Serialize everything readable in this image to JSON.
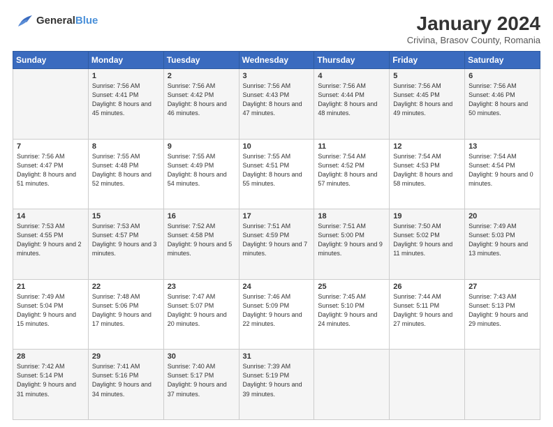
{
  "logo": {
    "general": "General",
    "blue": "Blue"
  },
  "title": "January 2024",
  "subtitle": "Crivina, Brasov County, Romania",
  "days_header": [
    "Sunday",
    "Monday",
    "Tuesday",
    "Wednesday",
    "Thursday",
    "Friday",
    "Saturday"
  ],
  "weeks": [
    [
      {
        "day": "",
        "sunrise": "",
        "sunset": "",
        "daylight": ""
      },
      {
        "day": "1",
        "sunrise": "Sunrise: 7:56 AM",
        "sunset": "Sunset: 4:41 PM",
        "daylight": "Daylight: 8 hours and 45 minutes."
      },
      {
        "day": "2",
        "sunrise": "Sunrise: 7:56 AM",
        "sunset": "Sunset: 4:42 PM",
        "daylight": "Daylight: 8 hours and 46 minutes."
      },
      {
        "day": "3",
        "sunrise": "Sunrise: 7:56 AM",
        "sunset": "Sunset: 4:43 PM",
        "daylight": "Daylight: 8 hours and 47 minutes."
      },
      {
        "day": "4",
        "sunrise": "Sunrise: 7:56 AM",
        "sunset": "Sunset: 4:44 PM",
        "daylight": "Daylight: 8 hours and 48 minutes."
      },
      {
        "day": "5",
        "sunrise": "Sunrise: 7:56 AM",
        "sunset": "Sunset: 4:45 PM",
        "daylight": "Daylight: 8 hours and 49 minutes."
      },
      {
        "day": "6",
        "sunrise": "Sunrise: 7:56 AM",
        "sunset": "Sunset: 4:46 PM",
        "daylight": "Daylight: 8 hours and 50 minutes."
      }
    ],
    [
      {
        "day": "7",
        "sunrise": "Sunrise: 7:56 AM",
        "sunset": "Sunset: 4:47 PM",
        "daylight": "Daylight: 8 hours and 51 minutes."
      },
      {
        "day": "8",
        "sunrise": "Sunrise: 7:55 AM",
        "sunset": "Sunset: 4:48 PM",
        "daylight": "Daylight: 8 hours and 52 minutes."
      },
      {
        "day": "9",
        "sunrise": "Sunrise: 7:55 AM",
        "sunset": "Sunset: 4:49 PM",
        "daylight": "Daylight: 8 hours and 54 minutes."
      },
      {
        "day": "10",
        "sunrise": "Sunrise: 7:55 AM",
        "sunset": "Sunset: 4:51 PM",
        "daylight": "Daylight: 8 hours and 55 minutes."
      },
      {
        "day": "11",
        "sunrise": "Sunrise: 7:54 AM",
        "sunset": "Sunset: 4:52 PM",
        "daylight": "Daylight: 8 hours and 57 minutes."
      },
      {
        "day": "12",
        "sunrise": "Sunrise: 7:54 AM",
        "sunset": "Sunset: 4:53 PM",
        "daylight": "Daylight: 8 hours and 58 minutes."
      },
      {
        "day": "13",
        "sunrise": "Sunrise: 7:54 AM",
        "sunset": "Sunset: 4:54 PM",
        "daylight": "Daylight: 9 hours and 0 minutes."
      }
    ],
    [
      {
        "day": "14",
        "sunrise": "Sunrise: 7:53 AM",
        "sunset": "Sunset: 4:55 PM",
        "daylight": "Daylight: 9 hours and 2 minutes."
      },
      {
        "day": "15",
        "sunrise": "Sunrise: 7:53 AM",
        "sunset": "Sunset: 4:57 PM",
        "daylight": "Daylight: 9 hours and 3 minutes."
      },
      {
        "day": "16",
        "sunrise": "Sunrise: 7:52 AM",
        "sunset": "Sunset: 4:58 PM",
        "daylight": "Daylight: 9 hours and 5 minutes."
      },
      {
        "day": "17",
        "sunrise": "Sunrise: 7:51 AM",
        "sunset": "Sunset: 4:59 PM",
        "daylight": "Daylight: 9 hours and 7 minutes."
      },
      {
        "day": "18",
        "sunrise": "Sunrise: 7:51 AM",
        "sunset": "Sunset: 5:00 PM",
        "daylight": "Daylight: 9 hours and 9 minutes."
      },
      {
        "day": "19",
        "sunrise": "Sunrise: 7:50 AM",
        "sunset": "Sunset: 5:02 PM",
        "daylight": "Daylight: 9 hours and 11 minutes."
      },
      {
        "day": "20",
        "sunrise": "Sunrise: 7:49 AM",
        "sunset": "Sunset: 5:03 PM",
        "daylight": "Daylight: 9 hours and 13 minutes."
      }
    ],
    [
      {
        "day": "21",
        "sunrise": "Sunrise: 7:49 AM",
        "sunset": "Sunset: 5:04 PM",
        "daylight": "Daylight: 9 hours and 15 minutes."
      },
      {
        "day": "22",
        "sunrise": "Sunrise: 7:48 AM",
        "sunset": "Sunset: 5:06 PM",
        "daylight": "Daylight: 9 hours and 17 minutes."
      },
      {
        "day": "23",
        "sunrise": "Sunrise: 7:47 AM",
        "sunset": "Sunset: 5:07 PM",
        "daylight": "Daylight: 9 hours and 20 minutes."
      },
      {
        "day": "24",
        "sunrise": "Sunrise: 7:46 AM",
        "sunset": "Sunset: 5:09 PM",
        "daylight": "Daylight: 9 hours and 22 minutes."
      },
      {
        "day": "25",
        "sunrise": "Sunrise: 7:45 AM",
        "sunset": "Sunset: 5:10 PM",
        "daylight": "Daylight: 9 hours and 24 minutes."
      },
      {
        "day": "26",
        "sunrise": "Sunrise: 7:44 AM",
        "sunset": "Sunset: 5:11 PM",
        "daylight": "Daylight: 9 hours and 27 minutes."
      },
      {
        "day": "27",
        "sunrise": "Sunrise: 7:43 AM",
        "sunset": "Sunset: 5:13 PM",
        "daylight": "Daylight: 9 hours and 29 minutes."
      }
    ],
    [
      {
        "day": "28",
        "sunrise": "Sunrise: 7:42 AM",
        "sunset": "Sunset: 5:14 PM",
        "daylight": "Daylight: 9 hours and 31 minutes."
      },
      {
        "day": "29",
        "sunrise": "Sunrise: 7:41 AM",
        "sunset": "Sunset: 5:16 PM",
        "daylight": "Daylight: 9 hours and 34 minutes."
      },
      {
        "day": "30",
        "sunrise": "Sunrise: 7:40 AM",
        "sunset": "Sunset: 5:17 PM",
        "daylight": "Daylight: 9 hours and 37 minutes."
      },
      {
        "day": "31",
        "sunrise": "Sunrise: 7:39 AM",
        "sunset": "Sunset: 5:19 PM",
        "daylight": "Daylight: 9 hours and 39 minutes."
      },
      {
        "day": "",
        "sunrise": "",
        "sunset": "",
        "daylight": ""
      },
      {
        "day": "",
        "sunrise": "",
        "sunset": "",
        "daylight": ""
      },
      {
        "day": "",
        "sunrise": "",
        "sunset": "",
        "daylight": ""
      }
    ]
  ]
}
